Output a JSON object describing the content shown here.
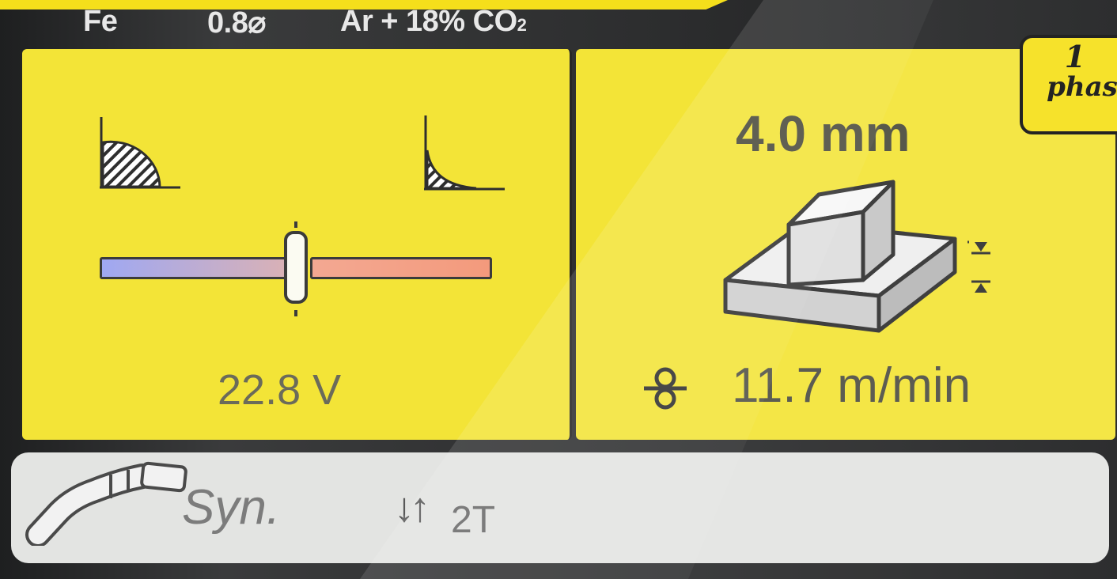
{
  "status_bar": {
    "material": "Fe",
    "wire_diameter": "0.8⌀",
    "gas_main": "Ar + 18% CO",
    "gas_subscript": "2"
  },
  "left_panel": {
    "arc_left_icon": "convex-weld-bead-icon",
    "arc_right_icon": "concave-weld-bead-icon",
    "slider_position_fraction": 0.48,
    "voltage": "22.8 V"
  },
  "right_panel": {
    "thickness": "4.0 mm",
    "joint_icon": "t-joint-icon",
    "wire_feed_icon": "wire-feed-roller-icon",
    "wire_feed_speed": "11.7  m/min"
  },
  "bottom_bar": {
    "torch_icon": "mig-torch-icon",
    "mode": "Syn.",
    "trigger_arrows": "↓↑",
    "trigger_mode": "2T"
  },
  "badge": {
    "number": "1",
    "word": "phas"
  },
  "colors": {
    "panel": "#f3e437",
    "bottom_bar": "#e3e4e2",
    "badge": "#f6e01a"
  }
}
